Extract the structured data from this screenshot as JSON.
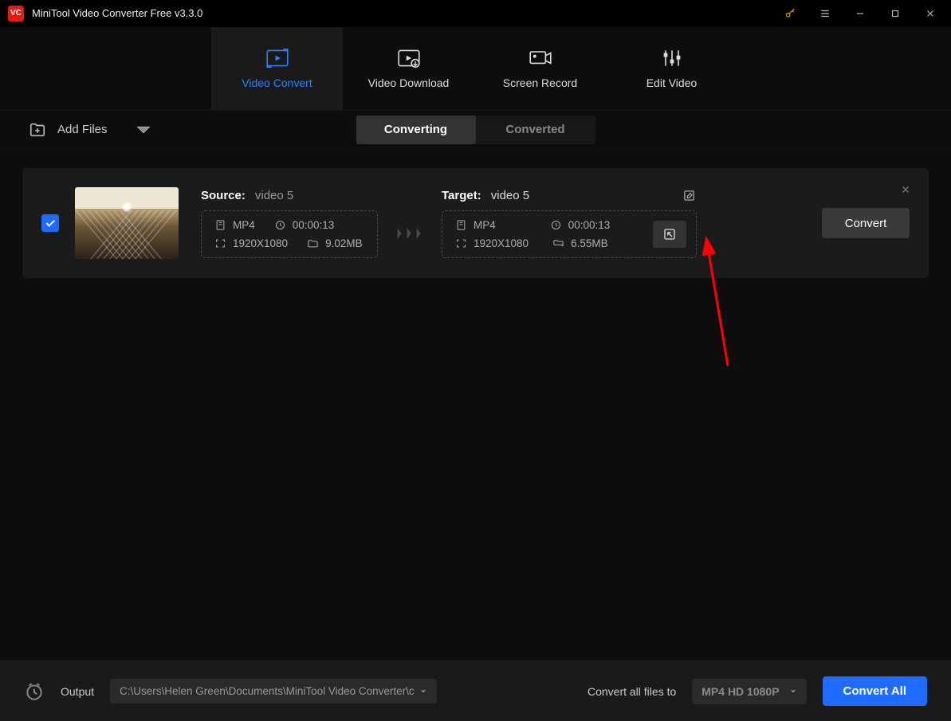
{
  "app": {
    "title": "MiniTool Video Converter Free v3.3.0"
  },
  "nav": {
    "tabs": [
      {
        "label": "Video Convert"
      },
      {
        "label": "Video Download"
      },
      {
        "label": "Screen Record"
      },
      {
        "label": "Edit Video"
      }
    ]
  },
  "toolbar": {
    "add_files": "Add Files",
    "status_tabs": [
      {
        "label": "Converting"
      },
      {
        "label": "Converted"
      }
    ]
  },
  "file": {
    "source": {
      "label": "Source:",
      "name": "video 5",
      "format": "MP4",
      "duration": "00:00:13",
      "resolution": "1920X1080",
      "size": "9.02MB"
    },
    "target": {
      "label": "Target:",
      "name": "video 5",
      "format": "MP4",
      "duration": "00:00:13",
      "resolution": "1920X1080",
      "size": "6.55MB"
    },
    "convert_button": "Convert"
  },
  "footer": {
    "output_label": "Output",
    "output_path": "C:\\Users\\Helen Green\\Documents\\MiniTool Video Converter\\c",
    "convert_all_label": "Convert all files to",
    "format_selected": "MP4 HD 1080P",
    "convert_all_button": "Convert All"
  }
}
